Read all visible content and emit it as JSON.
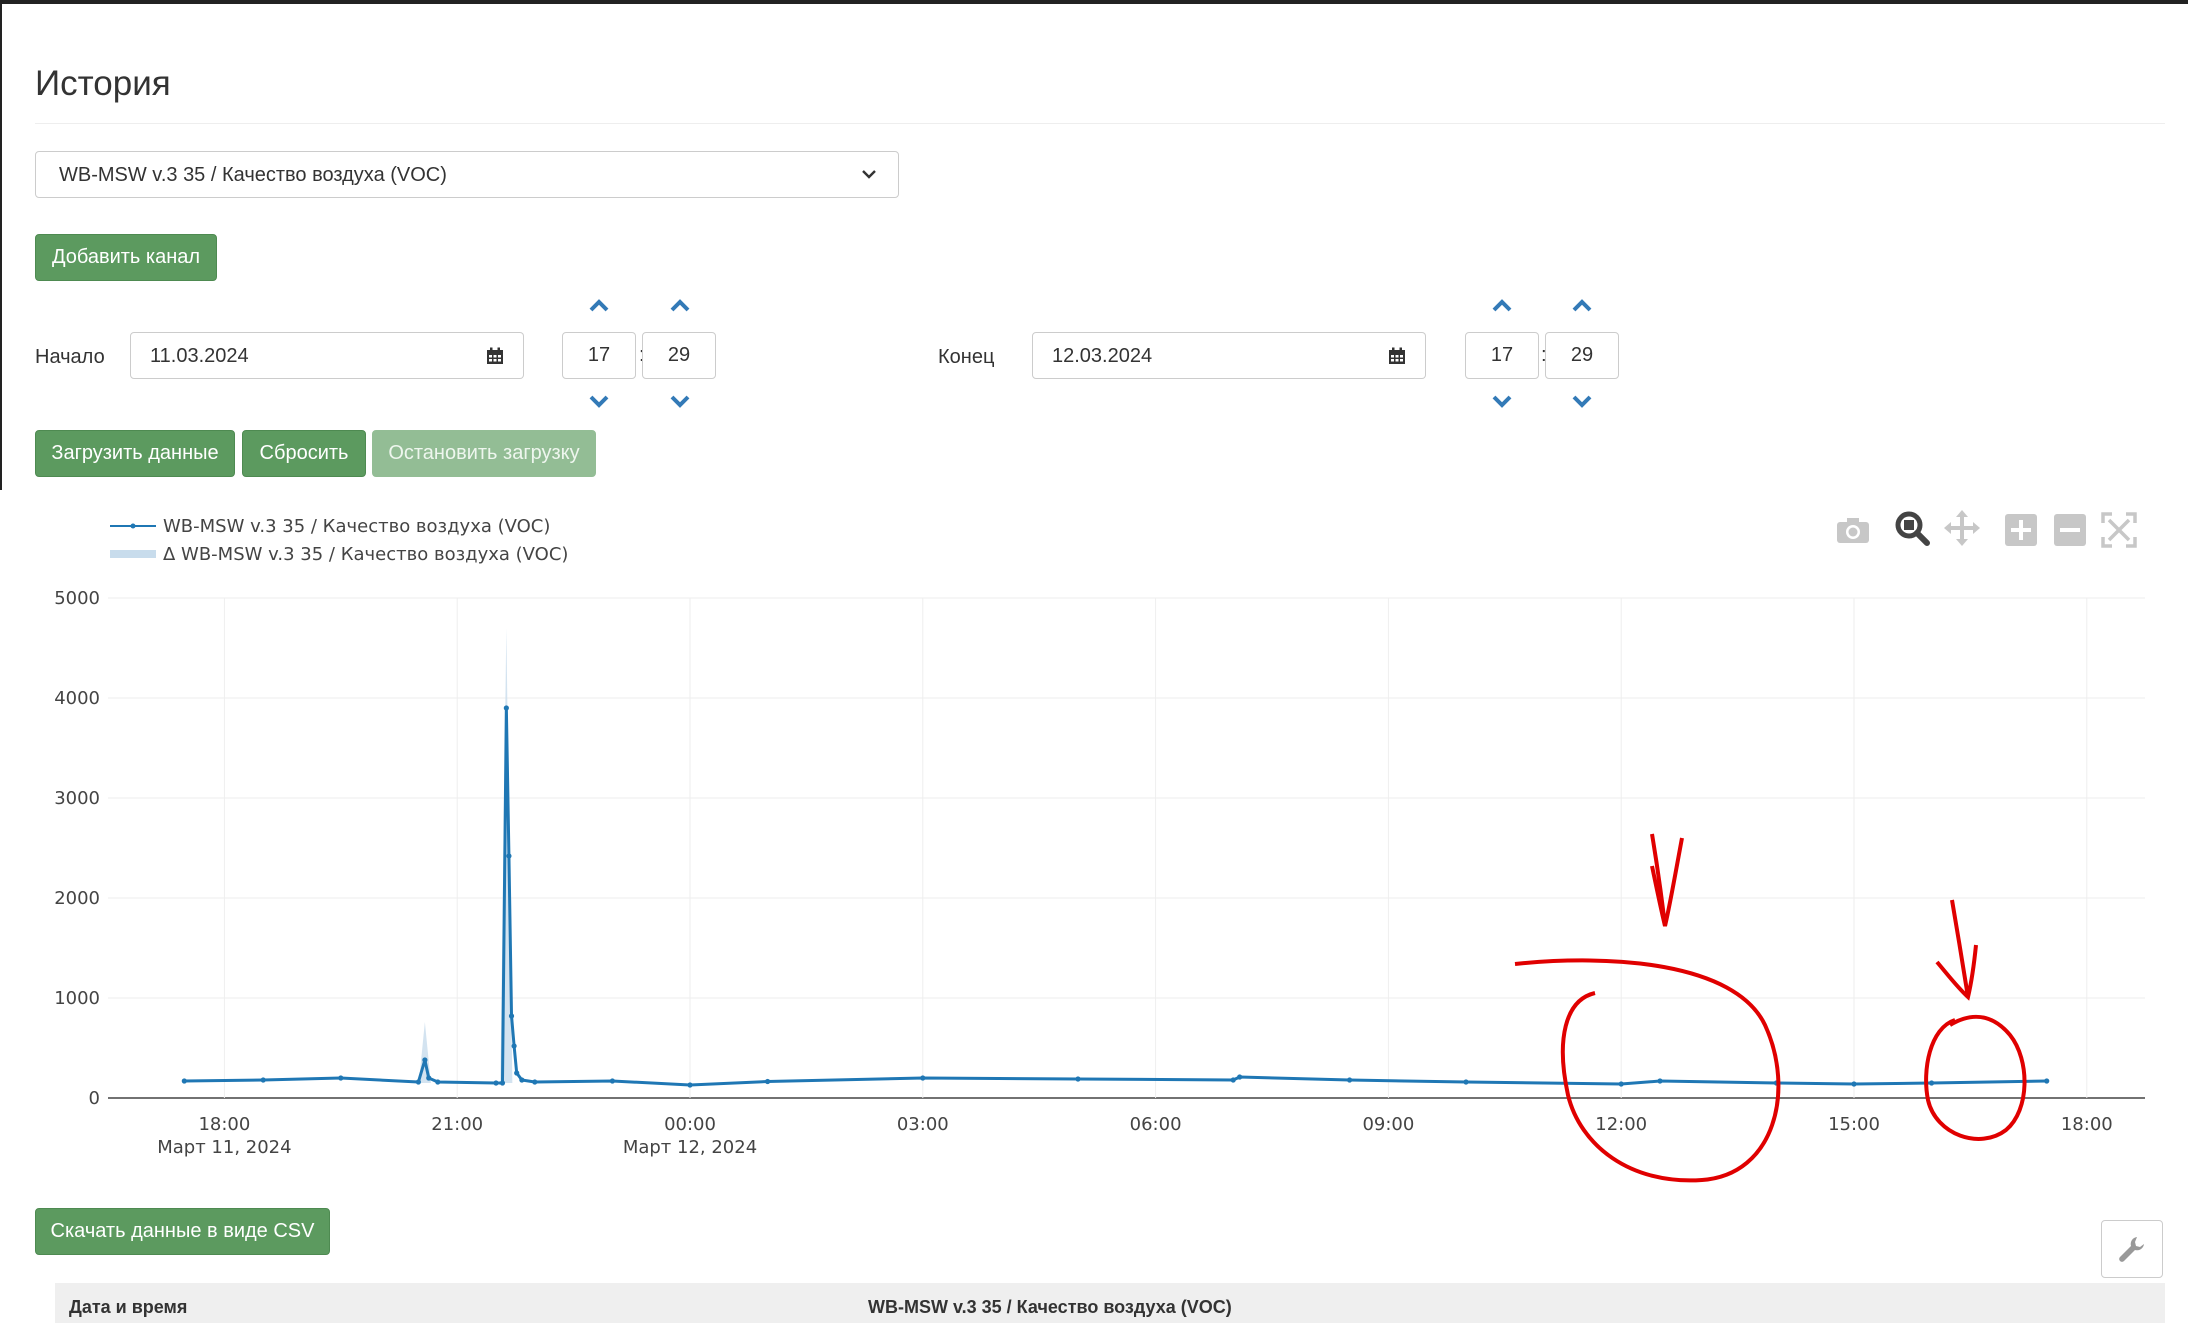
{
  "page": {
    "title": "История"
  },
  "channel_select": {
    "value": "WB-MSW v.3 35 / Качество воздуха (VOC)"
  },
  "buttons": {
    "add_channel": "Добавить канал",
    "load_data": "Загрузить данные",
    "reset": "Сбросить",
    "stop_loading": "Остановить загрузку",
    "download_csv": "Скачать данные в виде CSV"
  },
  "start": {
    "label": "Начало",
    "date": "11.03.2024",
    "hour": "17",
    "minute": "29"
  },
  "end": {
    "label": "Конец",
    "date": "12.03.2024",
    "hour": "17",
    "minute": "29"
  },
  "time_separator": ":",
  "icons": {
    "calendar": "calendar-icon",
    "up": "chevron-up-icon",
    "down": "chevron-down-icon",
    "camera": "camera-icon",
    "zoom": "zoom-icon",
    "pan": "pan-icon",
    "zoom_in": "zoom-in-icon",
    "zoom_out": "zoom-out-icon",
    "autoscale": "autoscale-icon",
    "wrench": "wrench-icon"
  },
  "colors": {
    "series": "#1f77b4",
    "band": "#c8dcec",
    "accent_green": "#5c9a5f",
    "annotation": "#e00000"
  },
  "chart_data": {
    "type": "line",
    "title": "",
    "legend_position": "top-left",
    "grid": true,
    "ylim": [
      0,
      5000
    ],
    "y_ticks": [
      "0",
      "1000",
      "2000",
      "3000",
      "4000",
      "5000"
    ],
    "x_ticks": [
      {
        "label": "18:00",
        "sub": "Март 11, 2024"
      },
      {
        "label": "21:00",
        "sub": ""
      },
      {
        "label": "00:00",
        "sub": "Март 12, 2024"
      },
      {
        "label": "03:00",
        "sub": ""
      },
      {
        "label": "06:00",
        "sub": ""
      },
      {
        "label": "09:00",
        "sub": ""
      },
      {
        "label": "12:00",
        "sub": ""
      },
      {
        "label": "15:00",
        "sub": ""
      },
      {
        "label": "18:00",
        "sub": ""
      }
    ],
    "series": [
      {
        "name": "WB-MSW v.3 35 / Качество воздуха (VOC)",
        "x": [
          "2024-03-11 17:29",
          "2024-03-11 18:30",
          "2024-03-11 19:30",
          "2024-03-11 20:30",
          "2024-03-11 20:35",
          "2024-03-11 20:38",
          "2024-03-11 20:45",
          "2024-03-11 21:30",
          "2024-03-11 21:35",
          "2024-03-11 21:38",
          "2024-03-11 21:40",
          "2024-03-11 21:42",
          "2024-03-11 21:44",
          "2024-03-11 21:46",
          "2024-03-11 21:50",
          "2024-03-11 22:00",
          "2024-03-11 23:00",
          "2024-03-12 00:00",
          "2024-03-12 01:00",
          "2024-03-12 03:00",
          "2024-03-12 05:00",
          "2024-03-12 07:00",
          "2024-03-12 07:05",
          "2024-03-12 08:30",
          "2024-03-12 10:00",
          "2024-03-12 12:00",
          "2024-03-12 12:30",
          "2024-03-12 14:00",
          "2024-03-12 15:00",
          "2024-03-12 16:00",
          "2024-03-12 17:29"
        ],
        "y": [
          170,
          180,
          200,
          160,
          380,
          200,
          160,
          150,
          150,
          3900,
          2420,
          820,
          520,
          250,
          180,
          160,
          170,
          130,
          165,
          200,
          190,
          180,
          210,
          180,
          160,
          140,
          170,
          150,
          140,
          150,
          170
        ]
      },
      {
        "name": "Δ WB-MSW v.3 35 / Качество воздуха (VOC)",
        "x": [
          "2024-03-11 20:35",
          "2024-03-11 21:38"
        ],
        "y": [
          760,
          4700
        ]
      }
    ]
  },
  "table": {
    "col_datetime": "Дата и время",
    "col_channel": "WB-MSW v.3 35 / Качество воздуха (VOC)"
  }
}
